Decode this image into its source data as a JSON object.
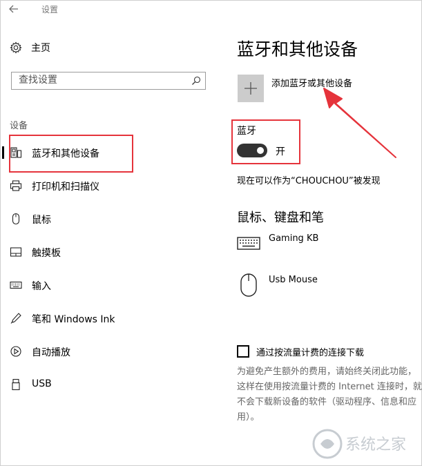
{
  "window": {
    "title": "设置"
  },
  "sidebar": {
    "home_label": "主页",
    "search": {
      "placeholder": "查找设置"
    },
    "section_header": "设备",
    "items": [
      {
        "label": "蓝牙和其他设备",
        "icon": "bluetooth-devices-icon",
        "active": true
      },
      {
        "label": "打印机和扫描仪",
        "icon": "printer-icon"
      },
      {
        "label": "鼠标",
        "icon": "mouse-icon"
      },
      {
        "label": "触摸板",
        "icon": "touchpad-icon"
      },
      {
        "label": "输入",
        "icon": "keyboard-icon"
      },
      {
        "label": "笔和 Windows Ink",
        "icon": "pen-icon"
      },
      {
        "label": "自动播放",
        "icon": "autoplay-icon"
      },
      {
        "label": "USB",
        "icon": "usb-icon"
      }
    ]
  },
  "main": {
    "title": "蓝牙和其他设备",
    "add_device_label": "添加蓝牙或其他设备",
    "bluetooth": {
      "header": "蓝牙",
      "toggle_state": "开",
      "on": true,
      "discoverable_text": "现在可以作为“CHOUCHOU”被发现"
    },
    "mouse_kb_pen": {
      "header": "鼠标、键盘和笔",
      "devices": [
        {
          "name": "Gaming KB",
          "icon": "keyboard-icon"
        },
        {
          "name": "Usb Mouse",
          "icon": "mouse-icon"
        }
      ]
    },
    "metered": {
      "checkbox_label": "通过按流量计费的连接下载",
      "checked": false,
      "help_text": "为避免产生额外的费用，请始终关闭此功能，这样在使用按流量计费的 Internet 连接时，就不会下载新设备的软件（驱动程序、信息和应用）。"
    }
  },
  "colors": {
    "highlight": "#e5333b",
    "toggle_on": "#333333",
    "add_tile": "#cccccc"
  },
  "watermark": "系统之家"
}
